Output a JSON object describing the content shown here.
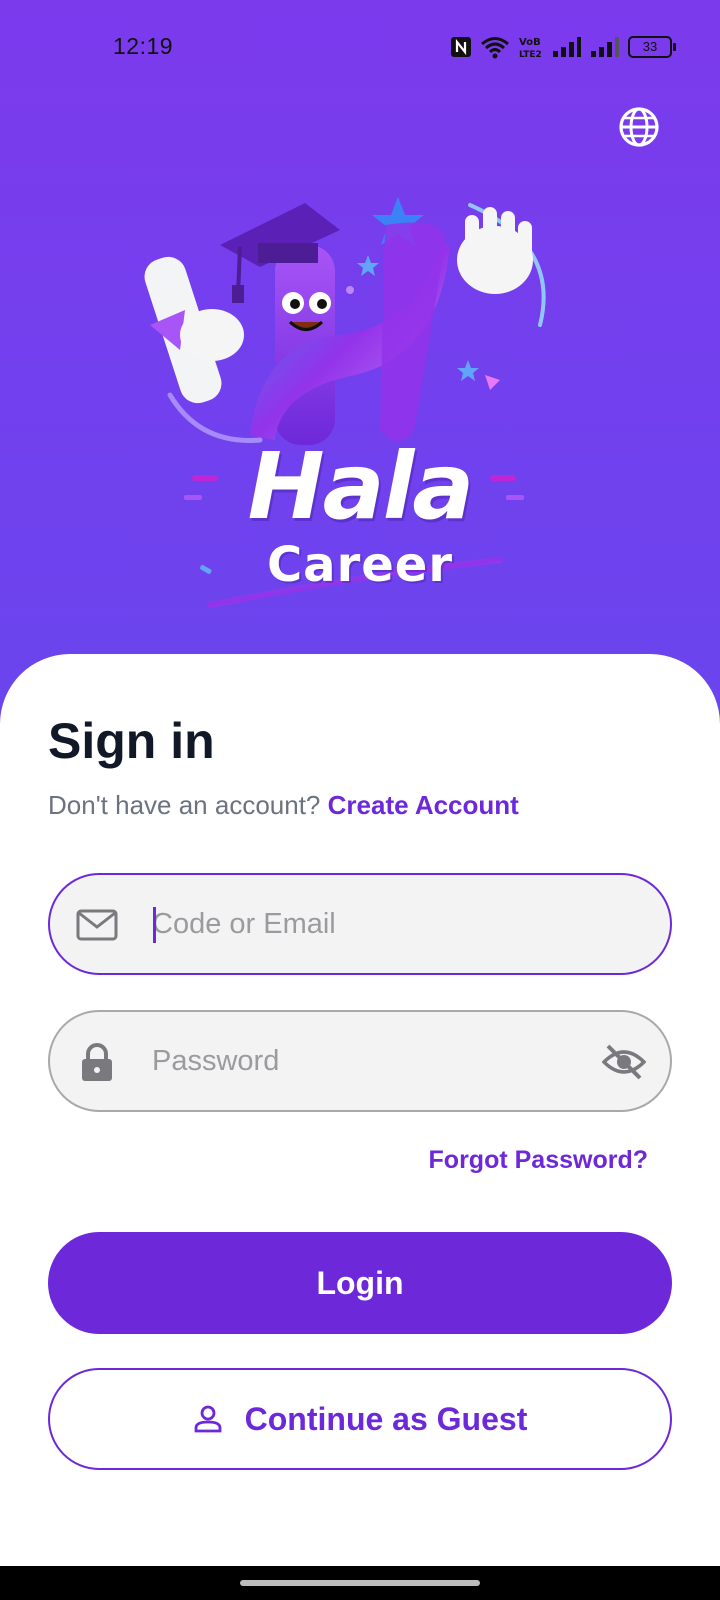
{
  "status_bar": {
    "time": "12:19",
    "battery_level": "33",
    "icons": [
      "nfc-icon",
      "wifi-icon",
      "volte-icon",
      "signal-icon",
      "signal-icon",
      "battery-icon"
    ]
  },
  "header": {
    "language_icon": "globe-icon"
  },
  "logo": {
    "word_main": "Hala",
    "word_sub": "Career"
  },
  "signin": {
    "title": "Sign in",
    "no_account_text": "Don't have an account?",
    "create_account_link": "Create Account",
    "email_placeholder": "Code or Email",
    "email_value": "",
    "email_icon": "mail-icon",
    "password_placeholder": "Password",
    "password_value": "",
    "password_icon": "lock-icon",
    "visibility_icon": "eye-off-icon",
    "forgot_password": "Forgot Password?",
    "login_button": "Login",
    "guest_button": "Continue as Guest",
    "guest_icon": "person-icon"
  },
  "colors": {
    "accent": "#6d28d9",
    "gradient_top": "#7c3aed",
    "gradient_bottom": "#5a55ef",
    "field_background": "#f3f3f4"
  }
}
